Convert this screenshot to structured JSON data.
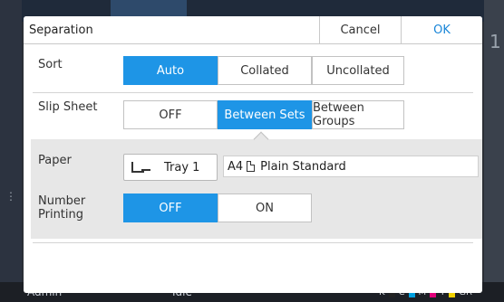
{
  "background": {
    "user_label": "Admin",
    "status_label": "Idle",
    "ink_labels": [
      "K",
      "C",
      "M",
      "Y",
      "GR"
    ],
    "ink_colors": [
      "#222222",
      "#00a0e0",
      "#e0007a",
      "#f0d000",
      "#888888"
    ]
  },
  "dialog": {
    "title": "Separation",
    "cancel_label": "Cancel",
    "ok_label": "OK"
  },
  "sort": {
    "label": "Sort",
    "options": [
      "Auto",
      "Collated",
      "Uncollated"
    ],
    "selected": "Auto"
  },
  "slip_sheet": {
    "label": "Slip Sheet",
    "options": [
      "OFF",
      "Between Sets",
      "Between Groups"
    ],
    "selected": "Between Sets"
  },
  "paper": {
    "label": "Paper",
    "tray_label": "Tray 1",
    "size": "A4",
    "type": "Plain Standard"
  },
  "number_printing": {
    "label": "Number Printing",
    "options": [
      "OFF",
      "ON"
    ],
    "selected": "OFF"
  },
  "colors": {
    "accent": "#1e95e6",
    "ok_text": "#1a86d8",
    "panel": "#e7e7e7"
  }
}
